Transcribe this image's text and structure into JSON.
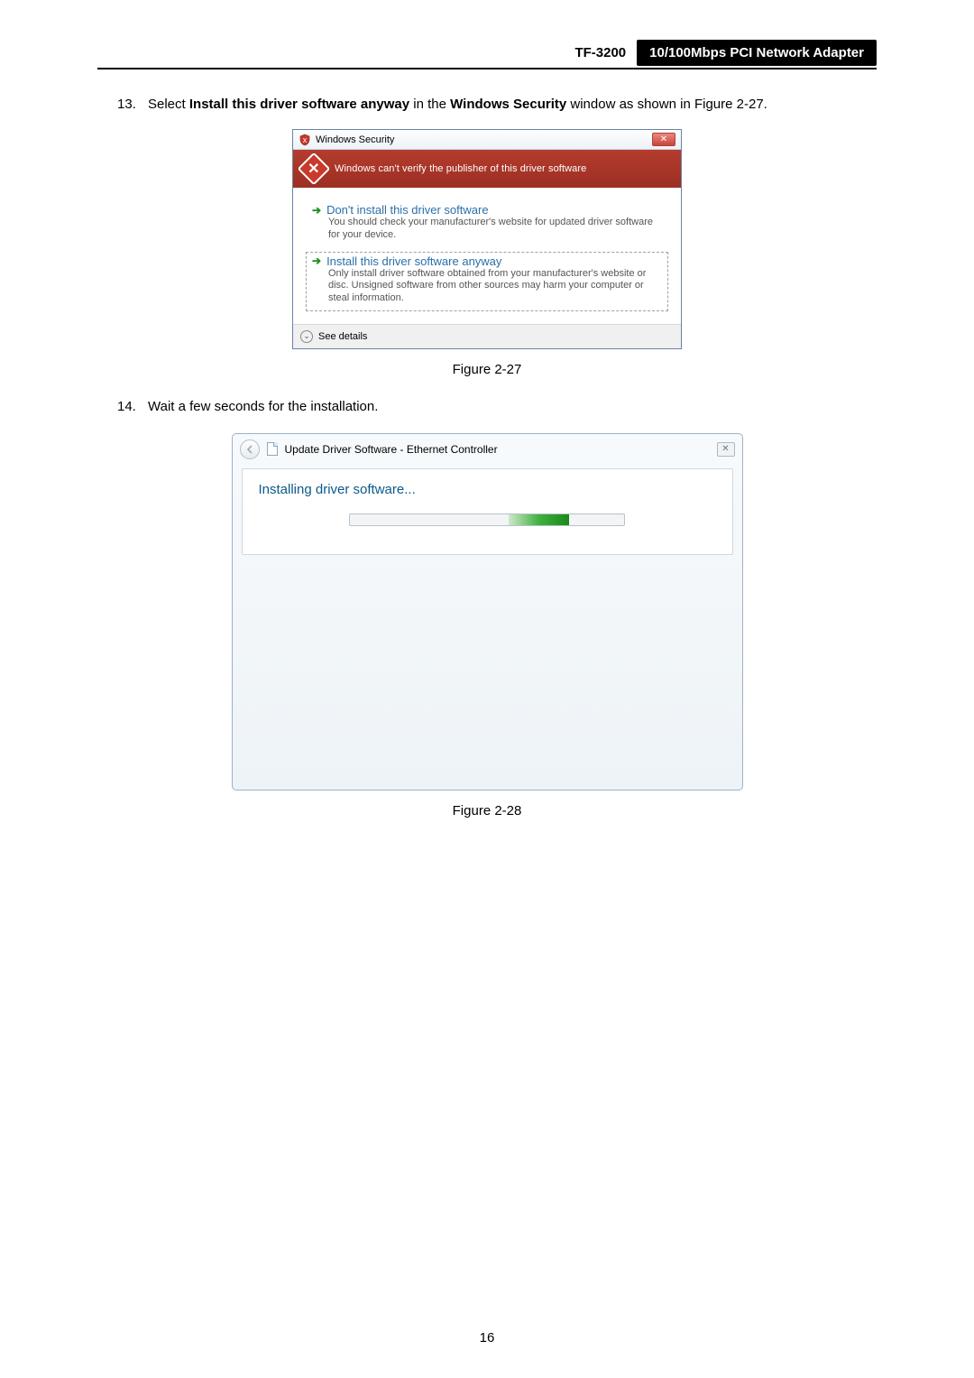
{
  "header": {
    "model": "TF-3200",
    "product": "10/100Mbps PCI Network Adapter"
  },
  "step13": {
    "number": "13.",
    "part1": "Select ",
    "bold1": "Install this driver software anyway",
    "part2": " in the ",
    "bold2": "Windows Security",
    "part3": " window as shown in Figure 2-27."
  },
  "dialog1": {
    "title": "Windows Security",
    "banner": "Windows can't verify the publisher of this driver software",
    "choice1": {
      "title": "Don't install this driver software",
      "desc": "You should check your manufacturer's website for updated driver software for your device."
    },
    "choice2": {
      "title": "Install this driver software anyway",
      "desc": "Only install driver software obtained from your manufacturer's website or disc. Unsigned software from other sources may harm your computer or steal information."
    },
    "seeDetails": "See details"
  },
  "caption1": "Figure 2-27",
  "step14": {
    "number": "14.",
    "text": "Wait a few seconds for the installation."
  },
  "dialog2": {
    "title": "Update Driver Software -  Ethernet Controller",
    "heading": "Installing driver software..."
  },
  "caption2": "Figure 2-28",
  "pageNumber": "16"
}
